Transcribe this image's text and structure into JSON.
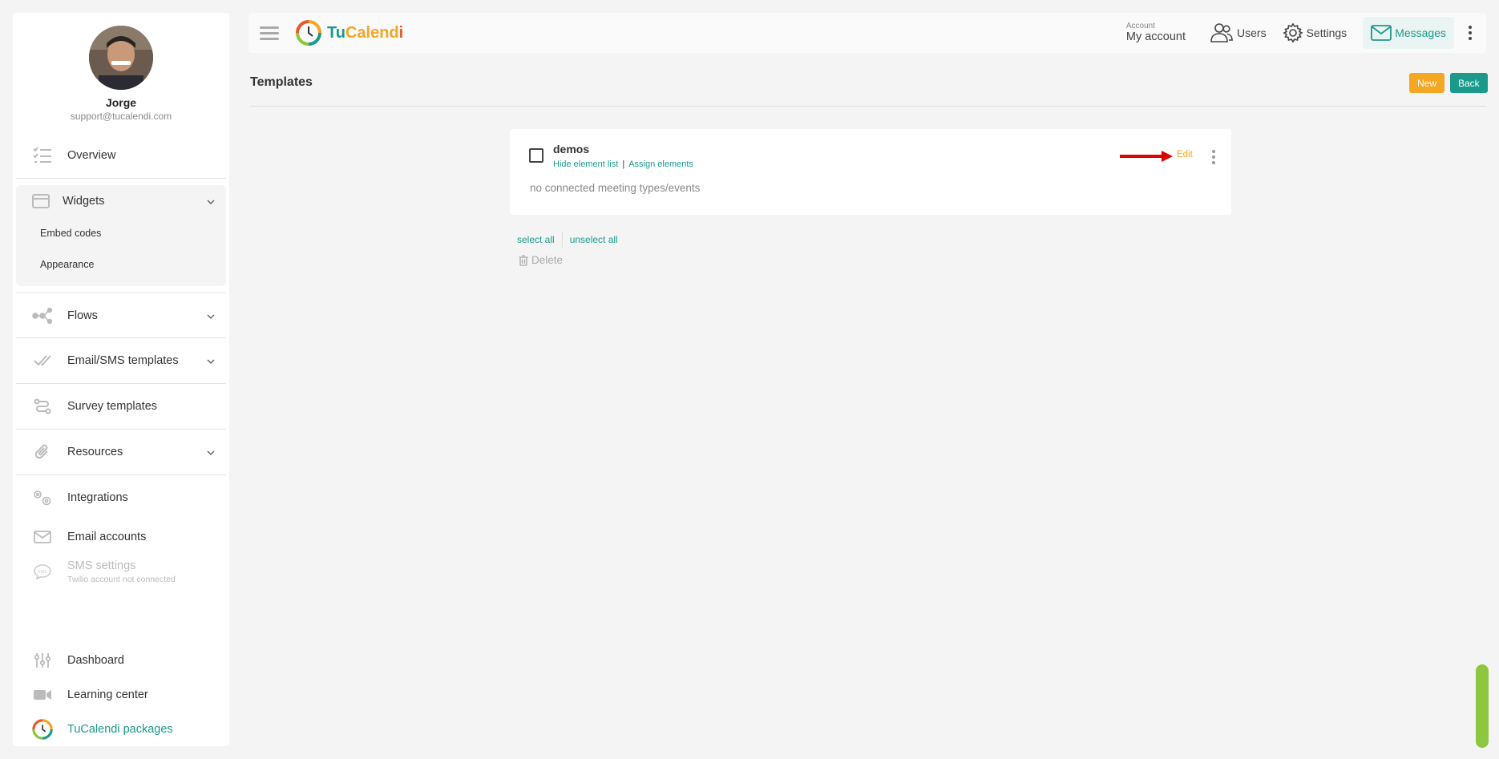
{
  "profile": {
    "name": "Jorge",
    "email": "support@tucalendi.com"
  },
  "sidebar": {
    "overview": "Overview",
    "widgets": {
      "label": "Widgets",
      "embed_codes": "Embed codes",
      "appearance": "Appearance"
    },
    "flows": "Flows",
    "email_sms": "Email/SMS templates",
    "survey": "Survey templates",
    "resources": "Resources",
    "integrations": "Integrations",
    "email_accounts": "Email accounts",
    "sms_settings": {
      "label": "SMS settings",
      "sub": "Twilio account not connected"
    },
    "dashboard": "Dashboard",
    "learning": "Learning center",
    "packages": "TuCalendi packages"
  },
  "header": {
    "logo": {
      "tu": "Tu",
      "calend": "Calend",
      "i": "i"
    },
    "account_small": "Account",
    "account_main": "My account",
    "users": "Users",
    "settings": "Settings",
    "messages": "Messages"
  },
  "page": {
    "title": "Templates",
    "new_label": "New",
    "back_label": "Back"
  },
  "card": {
    "title": "demos",
    "hide_list": "Hide element list",
    "assign": "Assign elements",
    "description": "no connected meeting types/events",
    "edit": "Edit"
  },
  "selection": {
    "select_all": "select all",
    "unselect_all": "unselect all",
    "delete": "Delete"
  },
  "colors": {
    "accent": "#1a9a8a",
    "orange": "#f5a623",
    "arrow": "#e00000",
    "scroll": "#8dc63f"
  }
}
